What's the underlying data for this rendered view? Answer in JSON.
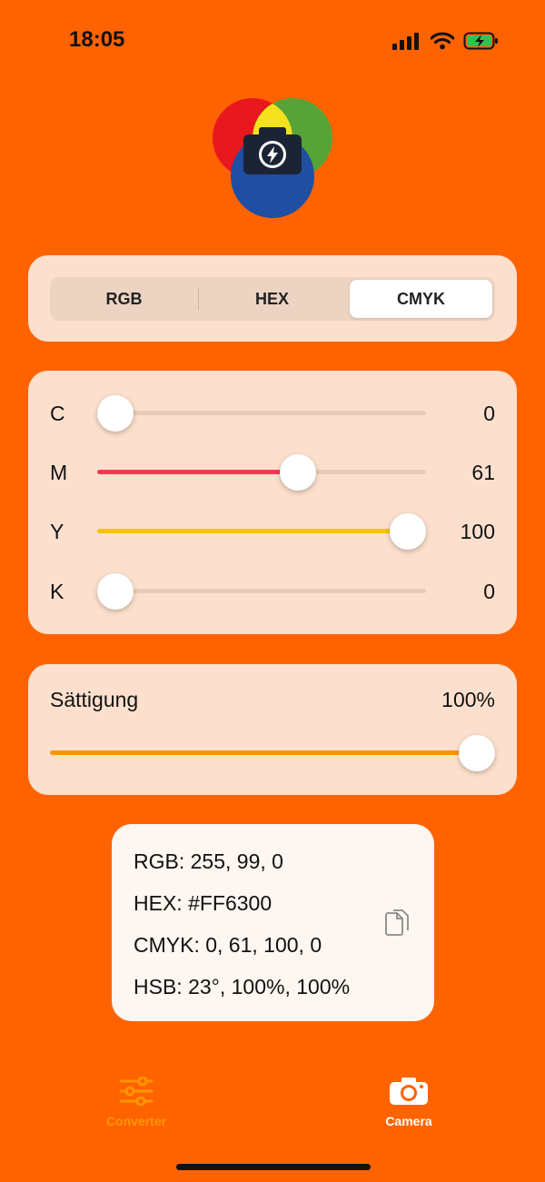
{
  "status_bar": {
    "time": "18:05"
  },
  "segmented": {
    "options": [
      "RGB",
      "HEX",
      "CMYK"
    ],
    "selected": "CMYK"
  },
  "cmyk_sliders": [
    {
      "label": "C",
      "value": "0",
      "fraction": 0,
      "color": "#E7CBBA"
    },
    {
      "label": "M",
      "value": "61",
      "fraction": 0.61,
      "color": "#F23A55"
    },
    {
      "label": "Y",
      "value": "100",
      "fraction": 1.0,
      "color": "#F5C400"
    },
    {
      "label": "K",
      "value": "0",
      "fraction": 0,
      "color": "#E7CBBA"
    }
  ],
  "saturation": {
    "label": "Sättigung",
    "value": "100%",
    "fraction": 1.0,
    "color": "#FF9500"
  },
  "result": {
    "rgb": "RGB: 255, 99, 0",
    "hex": "HEX: #FF6300",
    "cmyk": "CMYK: 0, 61, 100, 0",
    "hsb": "HSB: 23°, 100%, 100%",
    "copy_icon": "copy-icon"
  },
  "tabbar": {
    "items": [
      {
        "label": "Converter",
        "icon": "sliders-icon",
        "active": false
      },
      {
        "label": "Camera",
        "icon": "camera-icon",
        "active": true
      }
    ]
  },
  "colors": {
    "background": "#FF6300",
    "card": "#FCE0CD",
    "inactive_tab": "#FF9500",
    "active_tab": "#FFFFFF"
  }
}
